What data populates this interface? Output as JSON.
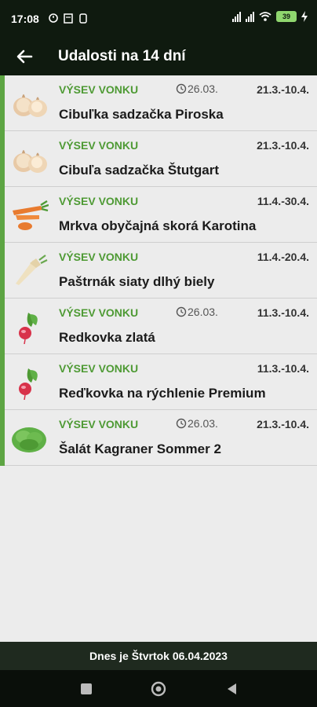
{
  "status": {
    "time": "17:08",
    "battery": "39"
  },
  "header": {
    "title": "Udalosti na 14 dní"
  },
  "events": [
    {
      "type": "VÝSEV VONKU",
      "history": "26.03.",
      "range": "21.3.-10.4.",
      "name": "Cibuľka sadzačka Piroska",
      "icon": "onion-icon"
    },
    {
      "type": "VÝSEV VONKU",
      "history": "",
      "range": "21.3.-10.4.",
      "name": "Cibuľa sadzačka Štutgart",
      "icon": "onion-icon"
    },
    {
      "type": "VÝSEV VONKU",
      "history": "",
      "range": "11.4.-30.4.",
      "name": "Mrkva obyčajná skorá Karotina",
      "icon": "carrot-icon"
    },
    {
      "type": "VÝSEV VONKU",
      "history": "",
      "range": "11.4.-20.4.",
      "name": "Paštrnák siaty dlhý biely",
      "icon": "parsnip-icon"
    },
    {
      "type": "VÝSEV VONKU",
      "history": "26.03.",
      "range": "11.3.-10.4.",
      "name": "Redkovka zlatá",
      "icon": "radish-icon"
    },
    {
      "type": "VÝSEV VONKU",
      "history": "",
      "range": "11.3.-10.4.",
      "name": "Reďkovka na rýchlenie Premium",
      "icon": "radish-icon"
    },
    {
      "type": "VÝSEV VONKU",
      "history": "26.03.",
      "range": "21.3.-10.4.",
      "name": "Šalát Kagraner Sommer 2",
      "icon": "lettuce-icon"
    }
  ],
  "footer": {
    "text": "Dnes je Štvrtok 06.04.2023"
  },
  "colors": {
    "accent": "#5da543",
    "type_text": "#4e9a34",
    "bar_bg": "#0f1a0f"
  }
}
